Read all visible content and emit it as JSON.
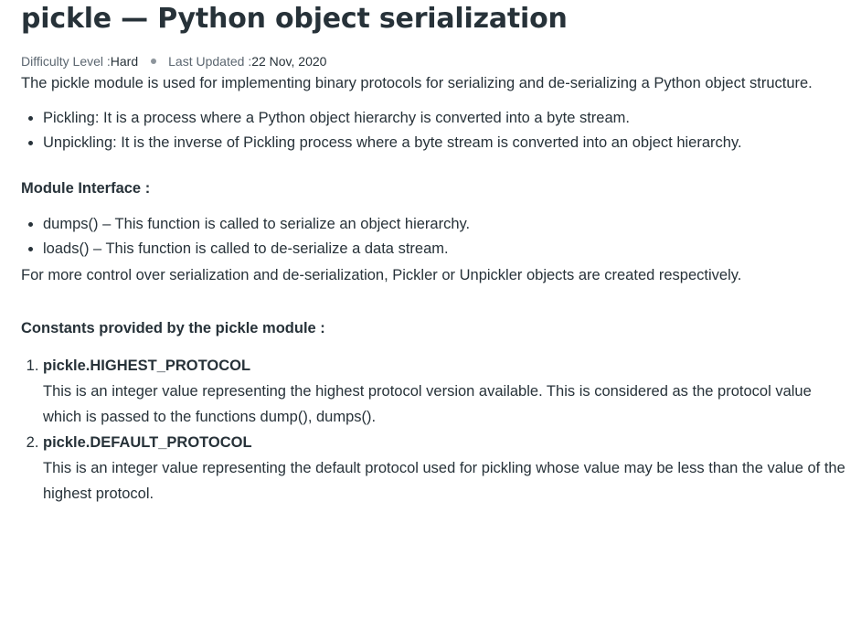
{
  "article": {
    "title": "pickle — Python object serialization",
    "meta": {
      "difficulty_label": "Difficulty Level : ",
      "difficulty_value": "Hard",
      "updated_label": "Last Updated : ",
      "updated_value": "22 Nov, 2020"
    },
    "intro": "The pickle module is used for implementing binary protocols for serializing and de-serializing a Python object structure.",
    "intro_bullets": [
      "Pickling: It is a process where a Python object hierarchy is converted into a byte stream.",
      "Unpickling: It is the inverse of Pickling process where a byte stream is converted into an object hierarchy."
    ],
    "module_interface": {
      "heading": "Module Interface :",
      "items": [
        "dumps() – This function is called to serialize an object hierarchy.",
        "loads() – This function is called to de-serialize a data stream."
      ],
      "note": "For more control over serialization and de-serialization, Pickler or Unpickler objects are created respectively."
    },
    "constants": {
      "heading": "Constants provided by the pickle module :",
      "items": [
        {
          "name": "pickle.HIGHEST_PROTOCOL",
          "description": "This is an integer value representing the highest protocol version available. This is considered as the protocol value which is passed to the functions dump(), dumps()."
        },
        {
          "name": "pickle.DEFAULT_PROTOCOL",
          "description": "This is an integer value representing the default protocol used for pickling whose value may be less than the value of the highest protocol."
        }
      ]
    }
  }
}
